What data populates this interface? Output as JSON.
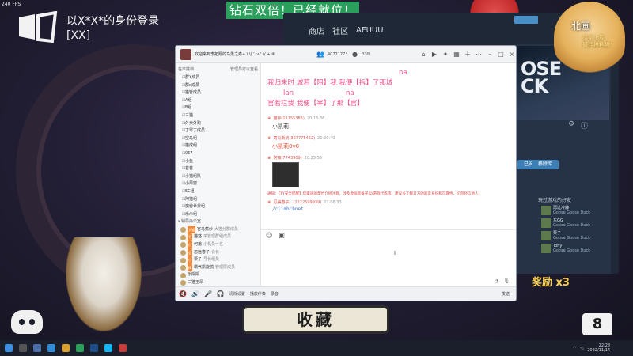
{
  "overlay": {
    "fps": "240 FPS",
    "login_text": "以X*X*的身份登录\n[XX]",
    "banner": "钻石双倍！已经就位！",
    "favorite_label": "收藏",
    "reward_label": "奖励 x3",
    "logo_text": "8",
    "char_top_name": "北画",
    "char_top_sub": "感谢上周\n最佳搭档猫"
  },
  "steam": {
    "nav": [
      "商店",
      "社区",
      "AFUUU"
    ],
    "art_text": "OSE\nCK",
    "buttons": [
      "已安装",
      "移除库"
    ],
    "friends_title": "玩过游戏的好友",
    "friends": [
      {
        "name": "再过冷静",
        "game": "Goose Goose Duck"
      },
      {
        "name": "东GG",
        "game": "Goose Goose Duck"
      },
      {
        "name": "栗子",
        "game": "Goose Goose Duck"
      },
      {
        "name": "Tony",
        "game": "Goose Goose Duck"
      }
    ]
  },
  "qq": {
    "title": "欢迎来到李拓翔的鸟巢之森+ \\ \\( ' ω ' )/ + ⑧",
    "member_count": "40771773",
    "online_count": "338",
    "sidebar_head": [
      "在率搭档",
      "管理员可以查看"
    ],
    "groups": [
      "群X成员",
      "群x成员",
      "猫管成员",
      "A组",
      "B组",
      "三猫",
      "外卖外购",
      "丁零丁成员",
      "空岛组",
      "猫成组",
      "067",
      "小鱼",
      "苍苍",
      "小猫组队",
      "小果窗",
      "5C组",
      "阿猫组",
      "魔兽世界组",
      "乐众组"
    ],
    "office_label": "辅导办公室",
    "members": [
      {
        "name": "官马蕉纱",
        "tag": "大猫",
        "role": "大猫分群成员"
      },
      {
        "name": "猫悠",
        "tag": "平",
        "role": "平管理群组成员"
      },
      {
        "name": "何落",
        "tag": "小",
        "role": "小机员一名"
      },
      {
        "name": "忽远春子",
        "tag": "会",
        "role": "会长"
      },
      {
        "name": "栗子",
        "tag": "小",
        "role": "号长组员"
      },
      {
        "name": "霸气凯旋鸽",
        "tag": "精",
        "role": "管理层成员"
      },
      {
        "name": "乐娟娟",
        "tag": "",
        "role": ""
      },
      {
        "name": "三猫王昂",
        "tag": "",
        "role": ""
      }
    ],
    "poem": [
      {
        "lead": "na",
        "text": "我归来时 城若【阻】我 我便【拆】了那城"
      },
      {
        "lead": "lan",
        "lead2": "na",
        "text": "官若拦我 我便【宰】了那【官】"
      }
    ],
    "messages": [
      {
        "name": "猫钟(11155385)",
        "time": "20:16:38",
        "body": "小凯莉",
        "red": false
      },
      {
        "name": "司马斯纳(367775452)",
        "time": "20:20:49",
        "body": "小凯莉0v0",
        "red": true
      },
      {
        "name": "阿薇(7743909)",
        "time": "20:25:55",
        "body": "",
        "image": true
      }
    ],
    "sys_note": "通知：【TY安全提醒】玩家间的帮忙介绍注意，涉及虚拟装备买卖/游戏代练等，建议多了解对方的真实身份和可靠性，切勿轻信他人!",
    "cmd_sender": "忍美春子。(2122599939)",
    "cmd_time": "22:06:33",
    "cmd": "/climbcbnet",
    "send_label": "发送",
    "bottombar": [
      "清除设置",
      "播放伴奏",
      "录音"
    ]
  },
  "taskbar": {
    "time": "22:28",
    "date": "2022/11/14"
  }
}
